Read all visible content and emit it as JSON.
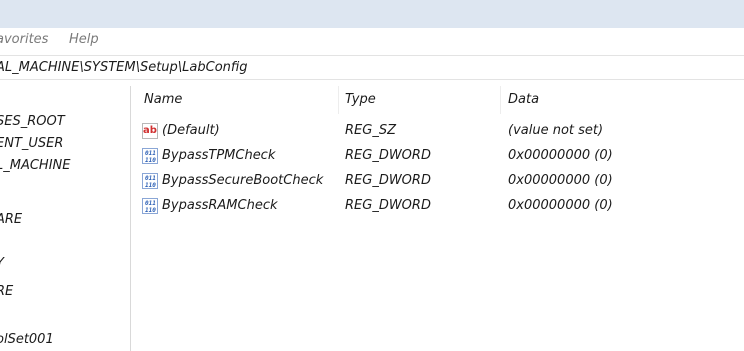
{
  "menu": {
    "favorites_label": "avorites",
    "help_label": "Help"
  },
  "address": {
    "path": "AL_MACHINE\\SYSTEM\\Setup\\LabConfig"
  },
  "tree": {
    "items": [
      "SES_ROOT",
      "ENT_USER",
      "L_MACHINE",
      "ARE",
      "Y",
      "RE",
      "olSet001"
    ]
  },
  "list": {
    "columns": [
      "Name",
      "Type",
      "Data"
    ],
    "rows": [
      {
        "icon": "string-value-icon",
        "name": "(Default)",
        "type": "REG_SZ",
        "data": "(value not set)"
      },
      {
        "icon": "binary-value-icon",
        "name": "BypassTPMCheck",
        "type": "REG_DWORD",
        "data": "0x00000000 (0)"
      },
      {
        "icon": "binary-value-icon",
        "name": "BypassSecureBootCheck",
        "type": "REG_DWORD",
        "data": "0x00000000 (0)"
      },
      {
        "icon": "binary-value-icon",
        "name": "BypassRAMCheck",
        "type": "REG_DWORD",
        "data": "0x00000000 (0)"
      }
    ]
  },
  "colors": {
    "titlebar": "#dde6f1",
    "string_icon_red": "#d03030",
    "binary_icon_blue": "#2b5fb5"
  }
}
